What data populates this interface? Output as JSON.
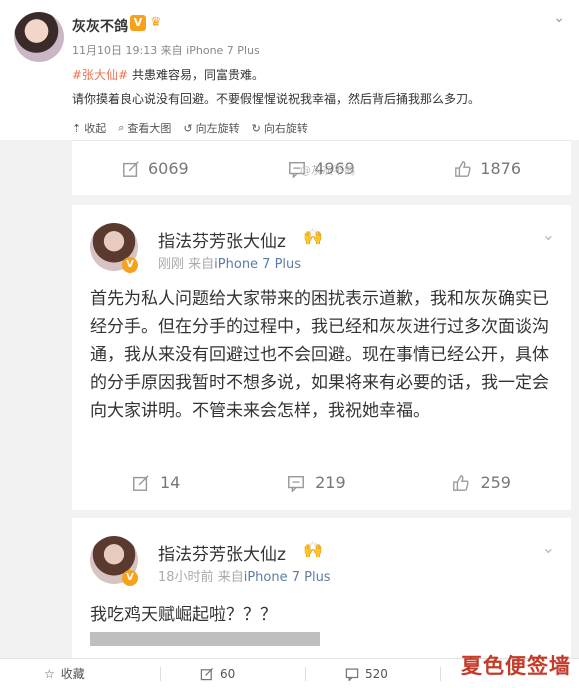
{
  "post": {
    "username": "灰灰不鸽",
    "v_badge": "V",
    "meta": "11月10日 19:13 来自 iPhone 7 Plus",
    "text_tag": "#张大仙#",
    "text_line1_rest": " 共患难容易，同富贵难。",
    "text_line2": "请你摸着良心说没有回避。不要假惺惺说祝我幸福，然后背后捅我那么多刀。",
    "actions": [
      "收起",
      "查看大图",
      "向左旋转",
      "向右旋转"
    ]
  },
  "card1": {
    "share": "6069",
    "comment": "4969",
    "like": "1876"
  },
  "card2": {
    "name": "指法芬芳张大仙z",
    "badge": "V",
    "time": "刚刚",
    "source_prefix": "来自",
    "source": "iPhone 7 Plus",
    "body": "首先为私人问题给大家带来的困扰表示道歉，我和灰灰确实已经分手。但在分手的过程中，我已经和灰灰进行过多次面谈沟通，我从来没有回避过也不会回避。现在事情已经公开，具体的分手原因我暂时不想多说，如果将来有必要的话，我一定会向大家讲明。不管未来会怎样，我祝她幸福。",
    "share": "14",
    "comment": "219",
    "like": "259"
  },
  "card3": {
    "name": "指法芬芳张大仙z",
    "badge": "V",
    "time": "18小时前",
    "source_prefix": "来自",
    "source": "iPhone 7 Plus",
    "body": "我吃鸡天赋崛起啦？？？",
    "small_watermark": "@灰灰不鸽"
  },
  "bottom": {
    "favorite": "收藏",
    "share": "60",
    "comment": "520"
  },
  "watermark": "夏色便签墙",
  "colors": {
    "accent": "#eb7350",
    "badge": "#f7a21b",
    "link": "#5b7ca7",
    "watermark": "#c53b2a"
  }
}
